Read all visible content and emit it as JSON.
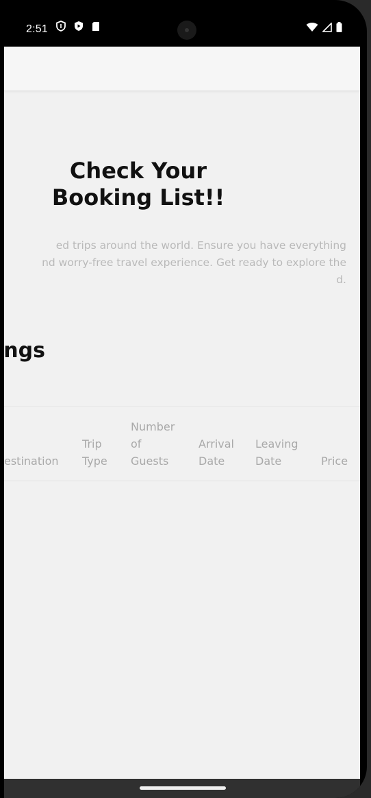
{
  "status_bar": {
    "time": "2:51",
    "left_icons": [
      "vpn-shield-icon",
      "shield-play-icon",
      "sd-card-icon"
    ],
    "right_icons": [
      "wifi-icon",
      "signal-icon",
      "battery-icon"
    ]
  },
  "hero": {
    "title_line1": "Check Your",
    "title_line2": "Booking List!!",
    "desc_line1": "ed trips around the world. Ensure you have everything",
    "desc_line2": "nd worry-free travel experience. Get ready to explore the",
    "desc_line3": "d."
  },
  "section": {
    "heading": "ngs"
  },
  "table": {
    "headers": [
      {
        "lines": [
          "estination"
        ]
      },
      {
        "lines": [
          "Trip",
          "Type"
        ]
      },
      {
        "lines": [
          "Number",
          "of",
          "Guests"
        ]
      },
      {
        "lines": [
          "Arrival",
          "Date"
        ]
      },
      {
        "lines": [
          "Leaving",
          "Date"
        ]
      },
      {
        "lines": [
          "Price"
        ]
      }
    ]
  },
  "colors": {
    "screen_bg": "#f1f1f1",
    "title_text": "#111111",
    "muted_text": "#b9b9b9",
    "header_text": "#a9a9a9"
  }
}
